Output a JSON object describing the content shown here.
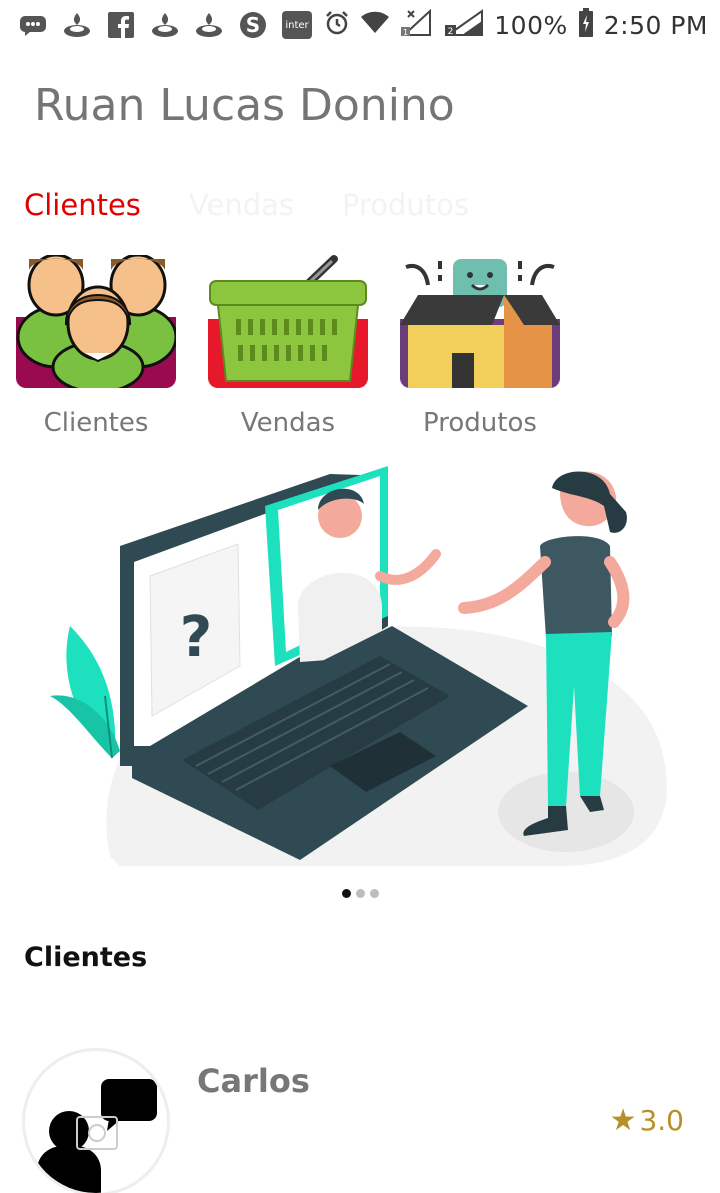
{
  "status_bar": {
    "battery": "100%",
    "time": "2:50 PM",
    "left_icons": [
      "message-icon",
      "santander-icon",
      "facebook-icon",
      "santander-icon",
      "santander-icon",
      "skype-icon",
      "inter-icon"
    ],
    "inter_label": "inter"
  },
  "title": "Ruan Lucas Donino",
  "tabs": [
    {
      "label": "Clientes",
      "active": true
    },
    {
      "label": "Vendas",
      "active": false
    },
    {
      "label": "Produtos",
      "active": false
    }
  ],
  "categories": [
    {
      "label": "Clientes",
      "icon": "clients-icon"
    },
    {
      "label": "Vendas",
      "icon": "basket-icon"
    },
    {
      "label": "Produtos",
      "icon": "product-box-icon"
    }
  ],
  "banner": {
    "icon": "support-illustration",
    "page_indicator": {
      "count": 3,
      "active": 1
    }
  },
  "section": {
    "title": "Clientes"
  },
  "clients": [
    {
      "name": "Carlos",
      "rating": "3.0",
      "avatar": "contact-avatar-icon"
    }
  ],
  "colors": {
    "accent": "#e10000",
    "rating": "#b8902a",
    "teal": "#1de0bf"
  }
}
